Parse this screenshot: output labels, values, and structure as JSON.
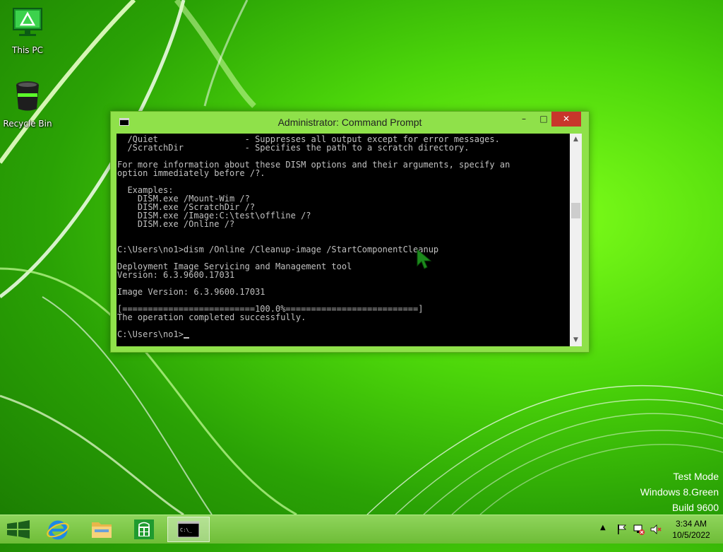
{
  "desktop": {
    "icons": [
      {
        "label": "This PC",
        "icon": "this-pc-icon"
      },
      {
        "label": "Recycle Bin",
        "icon": "recycle-bin-icon"
      }
    ],
    "watermark": {
      "line1": "Test Mode",
      "line2": "Windows 8.Green",
      "line3": "Build 9600"
    }
  },
  "window": {
    "title": "Administrator: Command Prompt",
    "buttons": {
      "minimize": "–",
      "maximize": "□",
      "close": "✕"
    },
    "console_text": "  /Quiet                 - Suppresses all output except for error messages.\n  /ScratchDir            - Specifies the path to a scratch directory.\n\nFor more information about these DISM options and their arguments, specify an\noption immediately before /?.\n\n  Examples:\n    DISM.exe /Mount-Wim /?\n    DISM.exe /ScratchDir /?\n    DISM.exe /Image:C:\\test\\offline /?\n    DISM.exe /Online /?\n\n\nC:\\Users\\no1>dism /Online /Cleanup-image /StartComponentCleanup\n\nDeployment Image Servicing and Management tool\nVersion: 6.3.9600.17031\n\nImage Version: 6.3.9600.17031\n\n[==========================100.0%==========================]\nThe operation completed successfully.\n\nC:\\Users\\no1>",
    "scroll_up": "▲",
    "scroll_down": "▼"
  },
  "taskbar": {
    "items": [
      {
        "name": "start",
        "icon": "windows-logo-icon"
      },
      {
        "name": "internet-explorer",
        "icon": "ie-icon"
      },
      {
        "name": "file-explorer",
        "icon": "folder-icon"
      },
      {
        "name": "store",
        "icon": "store-icon"
      },
      {
        "name": "command-prompt",
        "icon": "cmd-icon",
        "active": true
      }
    ],
    "tray": {
      "show_hidden": "▲",
      "icons": [
        "flag-icon",
        "network-icon",
        "volume-muted-icon"
      ]
    },
    "clock": {
      "time": "3:34 AM",
      "date": "10/5/2022"
    }
  },
  "colors": {
    "accent": "#7fff1a",
    "close_button": "#c8362b",
    "console_bg": "#000000",
    "console_fg": "#c0c0c0"
  }
}
